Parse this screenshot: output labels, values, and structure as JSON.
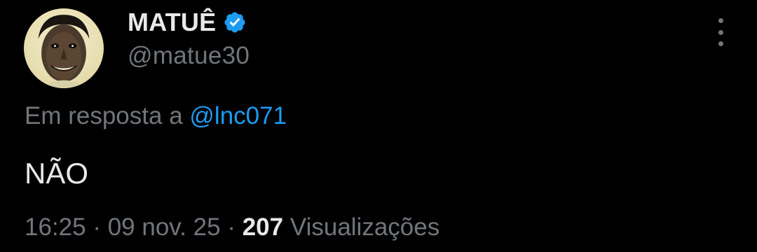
{
  "author": {
    "display_name": "MATUÊ",
    "handle": "@matue30",
    "verified": true,
    "avatar_icon": "avatar-face-icon"
  },
  "reply": {
    "prefix": "Em resposta a",
    "to_handle": "@lnc071"
  },
  "tweet": {
    "text": "NÃO"
  },
  "meta": {
    "time": "16:25",
    "separator": "·",
    "date": "09 nov. 25",
    "views_count": "207",
    "views_label": "Visualizações"
  },
  "icons": {
    "more": "more-vertical-icon",
    "verified": "verified-badge-icon"
  },
  "colors": {
    "background": "#000000",
    "text_primary": "#e7e9ea",
    "text_secondary": "#71767b",
    "accent": "#1d9bf0"
  }
}
